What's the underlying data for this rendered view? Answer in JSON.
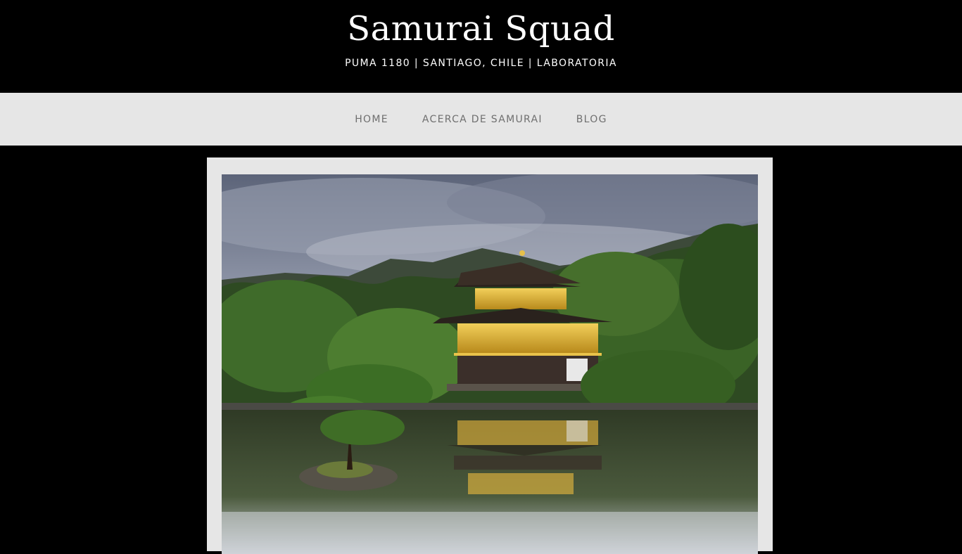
{
  "header": {
    "title": "Samurai Squad",
    "subtitle": "PUMA 1180 | SANTIAGO, CHILE | LABORATORIA"
  },
  "nav": {
    "items": [
      {
        "label": "HOME"
      },
      {
        "label": "ACERCA DE SAMURAI"
      },
      {
        "label": "BLOG"
      }
    ]
  },
  "hero": {
    "image_subject": "golden pavilion temple reflected in pond surrounded by pine trees",
    "icon": "photo-icon"
  },
  "colors": {
    "page_background": "#000000",
    "nav_background": "#e6e6e6",
    "frame_background": "#e6e6e6",
    "title_text": "#ffffff",
    "nav_text": "#6f6f6f"
  }
}
